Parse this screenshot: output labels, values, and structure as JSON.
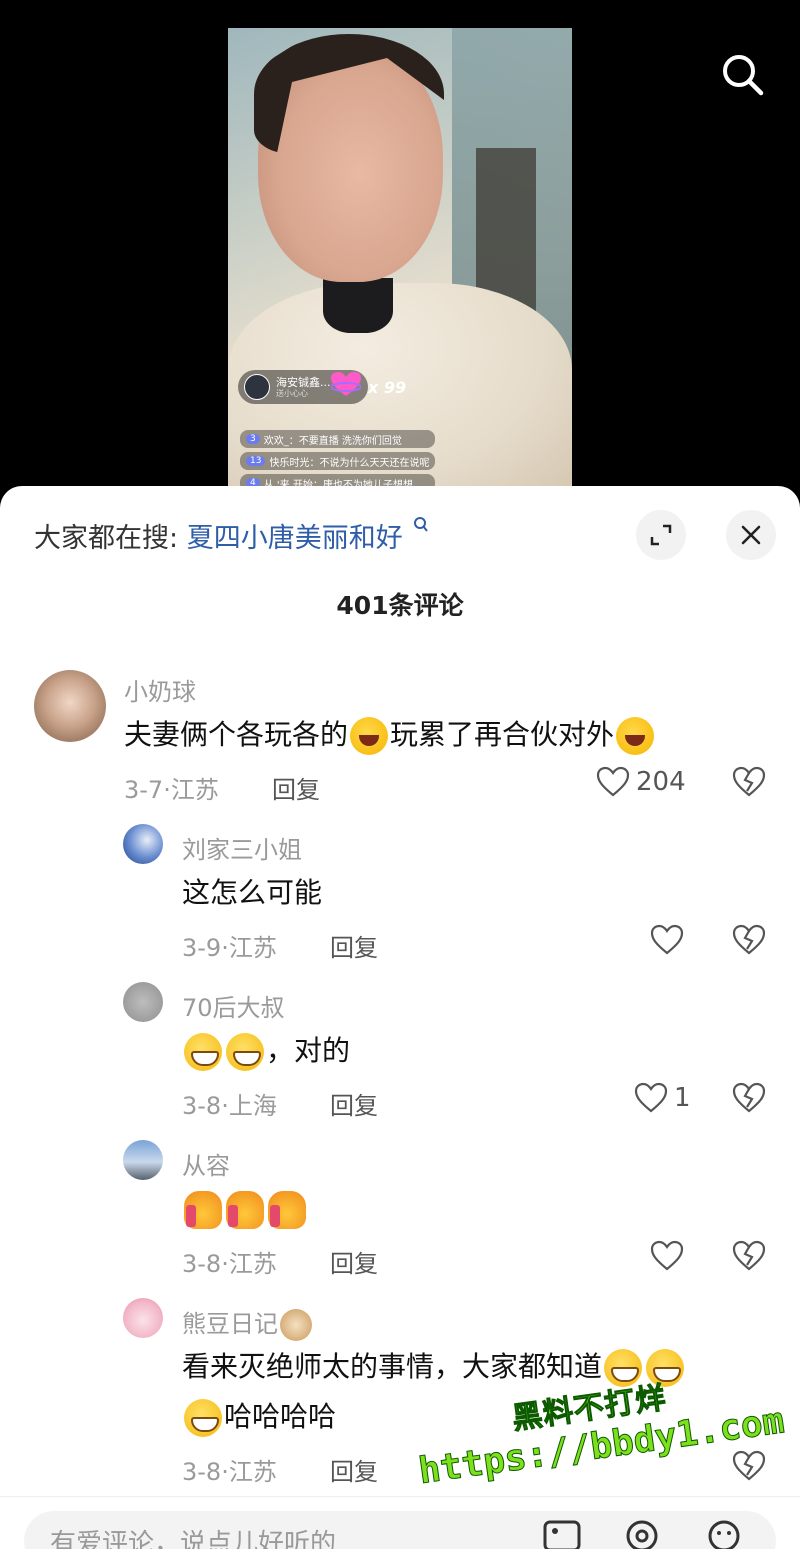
{
  "video": {
    "host_name": "海安铖鑫...",
    "host_sub": "送小心心",
    "gift_count": "x 99",
    "live_messages": [
      {
        "badge": "3",
        "text": "欢欢_：不要直播 洗洗你们回觉"
      },
      {
        "badge": "13",
        "text": "快乐时光：不说为什么天天还在说呢"
      },
      {
        "badge": "4",
        "text": "从 '来 开始：唐也不为她儿子想想"
      }
    ]
  },
  "sheet": {
    "hot_search_prefix": "大家都在搜:",
    "hot_search_link": "夏四小唐美丽和好",
    "comment_count": "401条评论"
  },
  "comments": [
    {
      "name": "小奶球",
      "text_before": "夫妻俩个各玩各的",
      "text_mid": "玩累了再合伙对外",
      "date": "3-7·江苏",
      "reply": "回复",
      "likes": "204"
    },
    {
      "name": "刘家三小姐",
      "text": "这怎么可能",
      "date": "3-9·江苏",
      "reply": "回复",
      "likes": ""
    },
    {
      "name": "70后大叔",
      "text_after": "，对的",
      "date": "3-8·上海",
      "reply": "回复",
      "likes": "1"
    },
    {
      "name": "从容",
      "date": "3-8·江苏",
      "reply": "回复",
      "likes": ""
    },
    {
      "name": "熊豆日记",
      "text_line1": "看来灭绝师太的事情，大家都知道",
      "text_line2": "哈哈哈哈",
      "date": "3-8·江苏",
      "reply": "回复"
    }
  ],
  "input": {
    "placeholder": "有爱评论，说点儿好听的"
  },
  "watermark": {
    "line1": "黑料不打烊",
    "line2": "https://bbdy1.com"
  },
  "colors": {
    "link": "#2f5ea8",
    "meta": "#9a9a9a",
    "watermark": "#7ee01d"
  }
}
